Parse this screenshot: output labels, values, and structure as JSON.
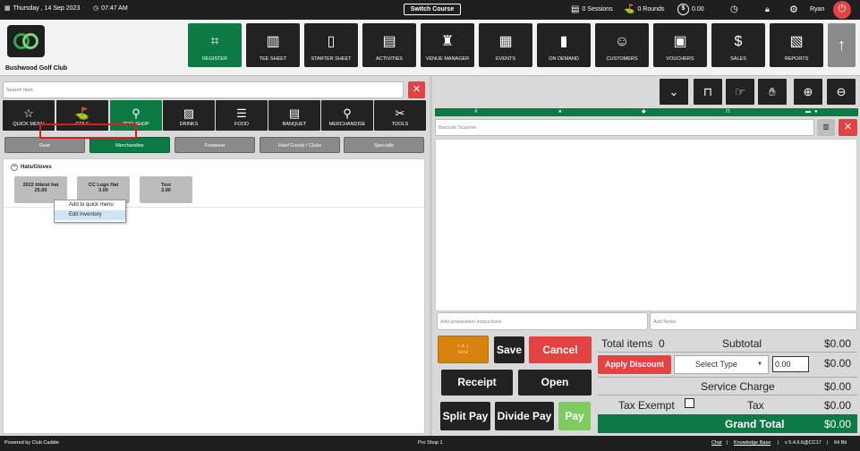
{
  "topbar": {
    "date": "Thursday , 14 Sep 2023",
    "time": "07:47 AM",
    "switch_course": "Switch Course",
    "sessions": "0 Sessions",
    "rounds": "0 Rounds",
    "balance": "0.00",
    "user": "Ryan"
  },
  "header": {
    "club_name": "Bushwood Golf Club",
    "nav": [
      {
        "label": "REGISTER",
        "icon": "barcode-scanner-icon"
      },
      {
        "label": "TEE SHEET",
        "icon": "tee-sheet-icon"
      },
      {
        "label": "STARTER SHEET",
        "icon": "tablet-icon"
      },
      {
        "label": "ACTIVITIES",
        "icon": "calendar-list-icon"
      },
      {
        "label": "VENUE MANAGER",
        "icon": "venue-icon"
      },
      {
        "label": "EVENTS",
        "icon": "events-calendar-icon"
      },
      {
        "label": "ON DEMAND",
        "icon": "phone-icon"
      },
      {
        "label": "CUSTOMERS",
        "icon": "customers-icon"
      },
      {
        "label": "VOUCHERS",
        "icon": "voucher-icon"
      },
      {
        "label": "SALES",
        "icon": "sales-icon"
      },
      {
        "label": "REPORTS",
        "icon": "reports-icon"
      }
    ]
  },
  "left": {
    "search_placeholder": "Search Item",
    "categories": [
      {
        "label": "QUICK MENU",
        "icon": "star-icon"
      },
      {
        "label": "GOLF",
        "icon": "golf-icon"
      },
      {
        "label": "PRO-SHOP",
        "icon": "pro-shop-icon"
      },
      {
        "label": "DRINKS",
        "icon": "drink-icon"
      },
      {
        "label": "FOOD",
        "icon": "food-icon"
      },
      {
        "label": "BANQUET",
        "icon": "banquet-icon"
      },
      {
        "label": "MERCHANDISE",
        "icon": "merchandise-icon"
      },
      {
        "label": "TOOLS",
        "icon": "tools-icon"
      }
    ],
    "subcategories": [
      "Gear",
      "Merchandise",
      "Footwear",
      "Hard Goods / Clubs",
      "Specialty"
    ],
    "group": "Hats/Gloves",
    "products": [
      {
        "name": "2022 titleist hat",
        "price": "25.00"
      },
      {
        "name": "CC Logo Hat",
        "price": "3.00"
      },
      {
        "name": "Test",
        "price": "3.90"
      }
    ],
    "context_menu": [
      "Add to quick menu",
      "Edit Inventory"
    ]
  },
  "right": {
    "barcode_placeholder": "Barcode Scanner",
    "prep_placeholder": "Add preparation instructions",
    "notes_placeholder": "Add Notes",
    "send_label": "Send",
    "buttons": {
      "save": "Save",
      "cancel": "Cancel",
      "receipt": "Receipt",
      "open": "Open",
      "split_pay": "Split Pay",
      "divide_pay": "Divide Pay",
      "pay": "Pay"
    },
    "totals": {
      "total_items_label": "Total items",
      "total_items": "0",
      "subtotal_label": "Subtotal",
      "subtotal": "$0.00",
      "apply_discount": "Apply Discount",
      "select_type": "Select Type",
      "discount_value": "0.00",
      "discount": "$0.00",
      "service_charge_label": "Service Charge",
      "service_charge": "$0.00",
      "tax_exempt_label": "Tax Exempt",
      "tax_label": "Tax",
      "tax": "$0.00",
      "grand_total_label": "Grand Total",
      "grand_total": "$0.00"
    }
  },
  "footer": {
    "powered_by": "Powered by Club Caddie",
    "station": "Pro Shop 1",
    "chat": "Chat",
    "kb": "Knowledge Base",
    "version": "v 5.4.6.6@CC17",
    "bits": "64 Bit"
  },
  "colors": {
    "brand_green": "#0d7a45",
    "danger_red": "#e34343",
    "send_orange": "#d78310",
    "pay_green": "#7fcb5f"
  }
}
